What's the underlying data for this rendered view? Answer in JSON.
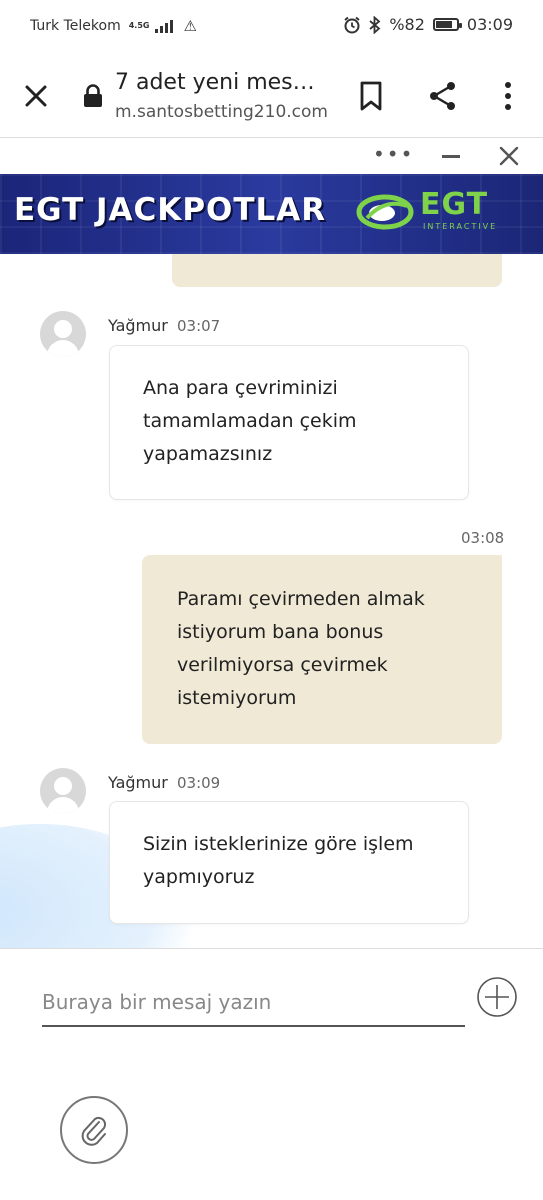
{
  "status_bar": {
    "carrier": "Turk Telekom",
    "network": "4.5G",
    "battery": "%82",
    "battery_level": 0.82,
    "time": "03:09",
    "icons": [
      "signal-icon",
      "warning-icon",
      "alarm-icon",
      "bluetooth-icon",
      "battery-icon"
    ]
  },
  "browser": {
    "title": "7 adet yeni mes…",
    "url": "m.santosbetting210.com",
    "icons": [
      "close-icon",
      "lock-icon",
      "bookmark-icon",
      "share-icon",
      "more-vert-icon"
    ]
  },
  "widget": {
    "icons": [
      "more-horiz-icon",
      "minimize-icon",
      "close-icon"
    ]
  },
  "banner": {
    "text": "EGT JACKPOTLAR",
    "logo_text": "EGT",
    "logo_sub": "INTERACTIVE",
    "colors": {
      "background": "#1e2a86",
      "logo": "#7fd34a"
    }
  },
  "messages": [
    {
      "direction": "incoming",
      "sender": "Yağmur",
      "time": "03:07",
      "lines": [
        "Ana para çevriminizi",
        "tamamlamadan çekim",
        "yapamazsınız"
      ]
    },
    {
      "direction": "outgoing",
      "time": "03:08",
      "lines": [
        "Paramı çevirmeden almak",
        "istiyorum bana bonus",
        "verilmiyorsa çevirmek",
        "istemiyorum"
      ]
    },
    {
      "direction": "incoming",
      "sender": "Yağmur",
      "time": "03:09",
      "lines": [
        "Sizin isteklerinize göre işlem",
        "yapmıyoruz"
      ]
    }
  ],
  "composer": {
    "placeholder": "Buraya bir mesaj yazın",
    "value": "",
    "icons": [
      "add-icon",
      "attach-icon"
    ]
  },
  "colors": {
    "outgoing_bubble": "#efe9d6",
    "incoming_border": "#e6e6e6"
  }
}
